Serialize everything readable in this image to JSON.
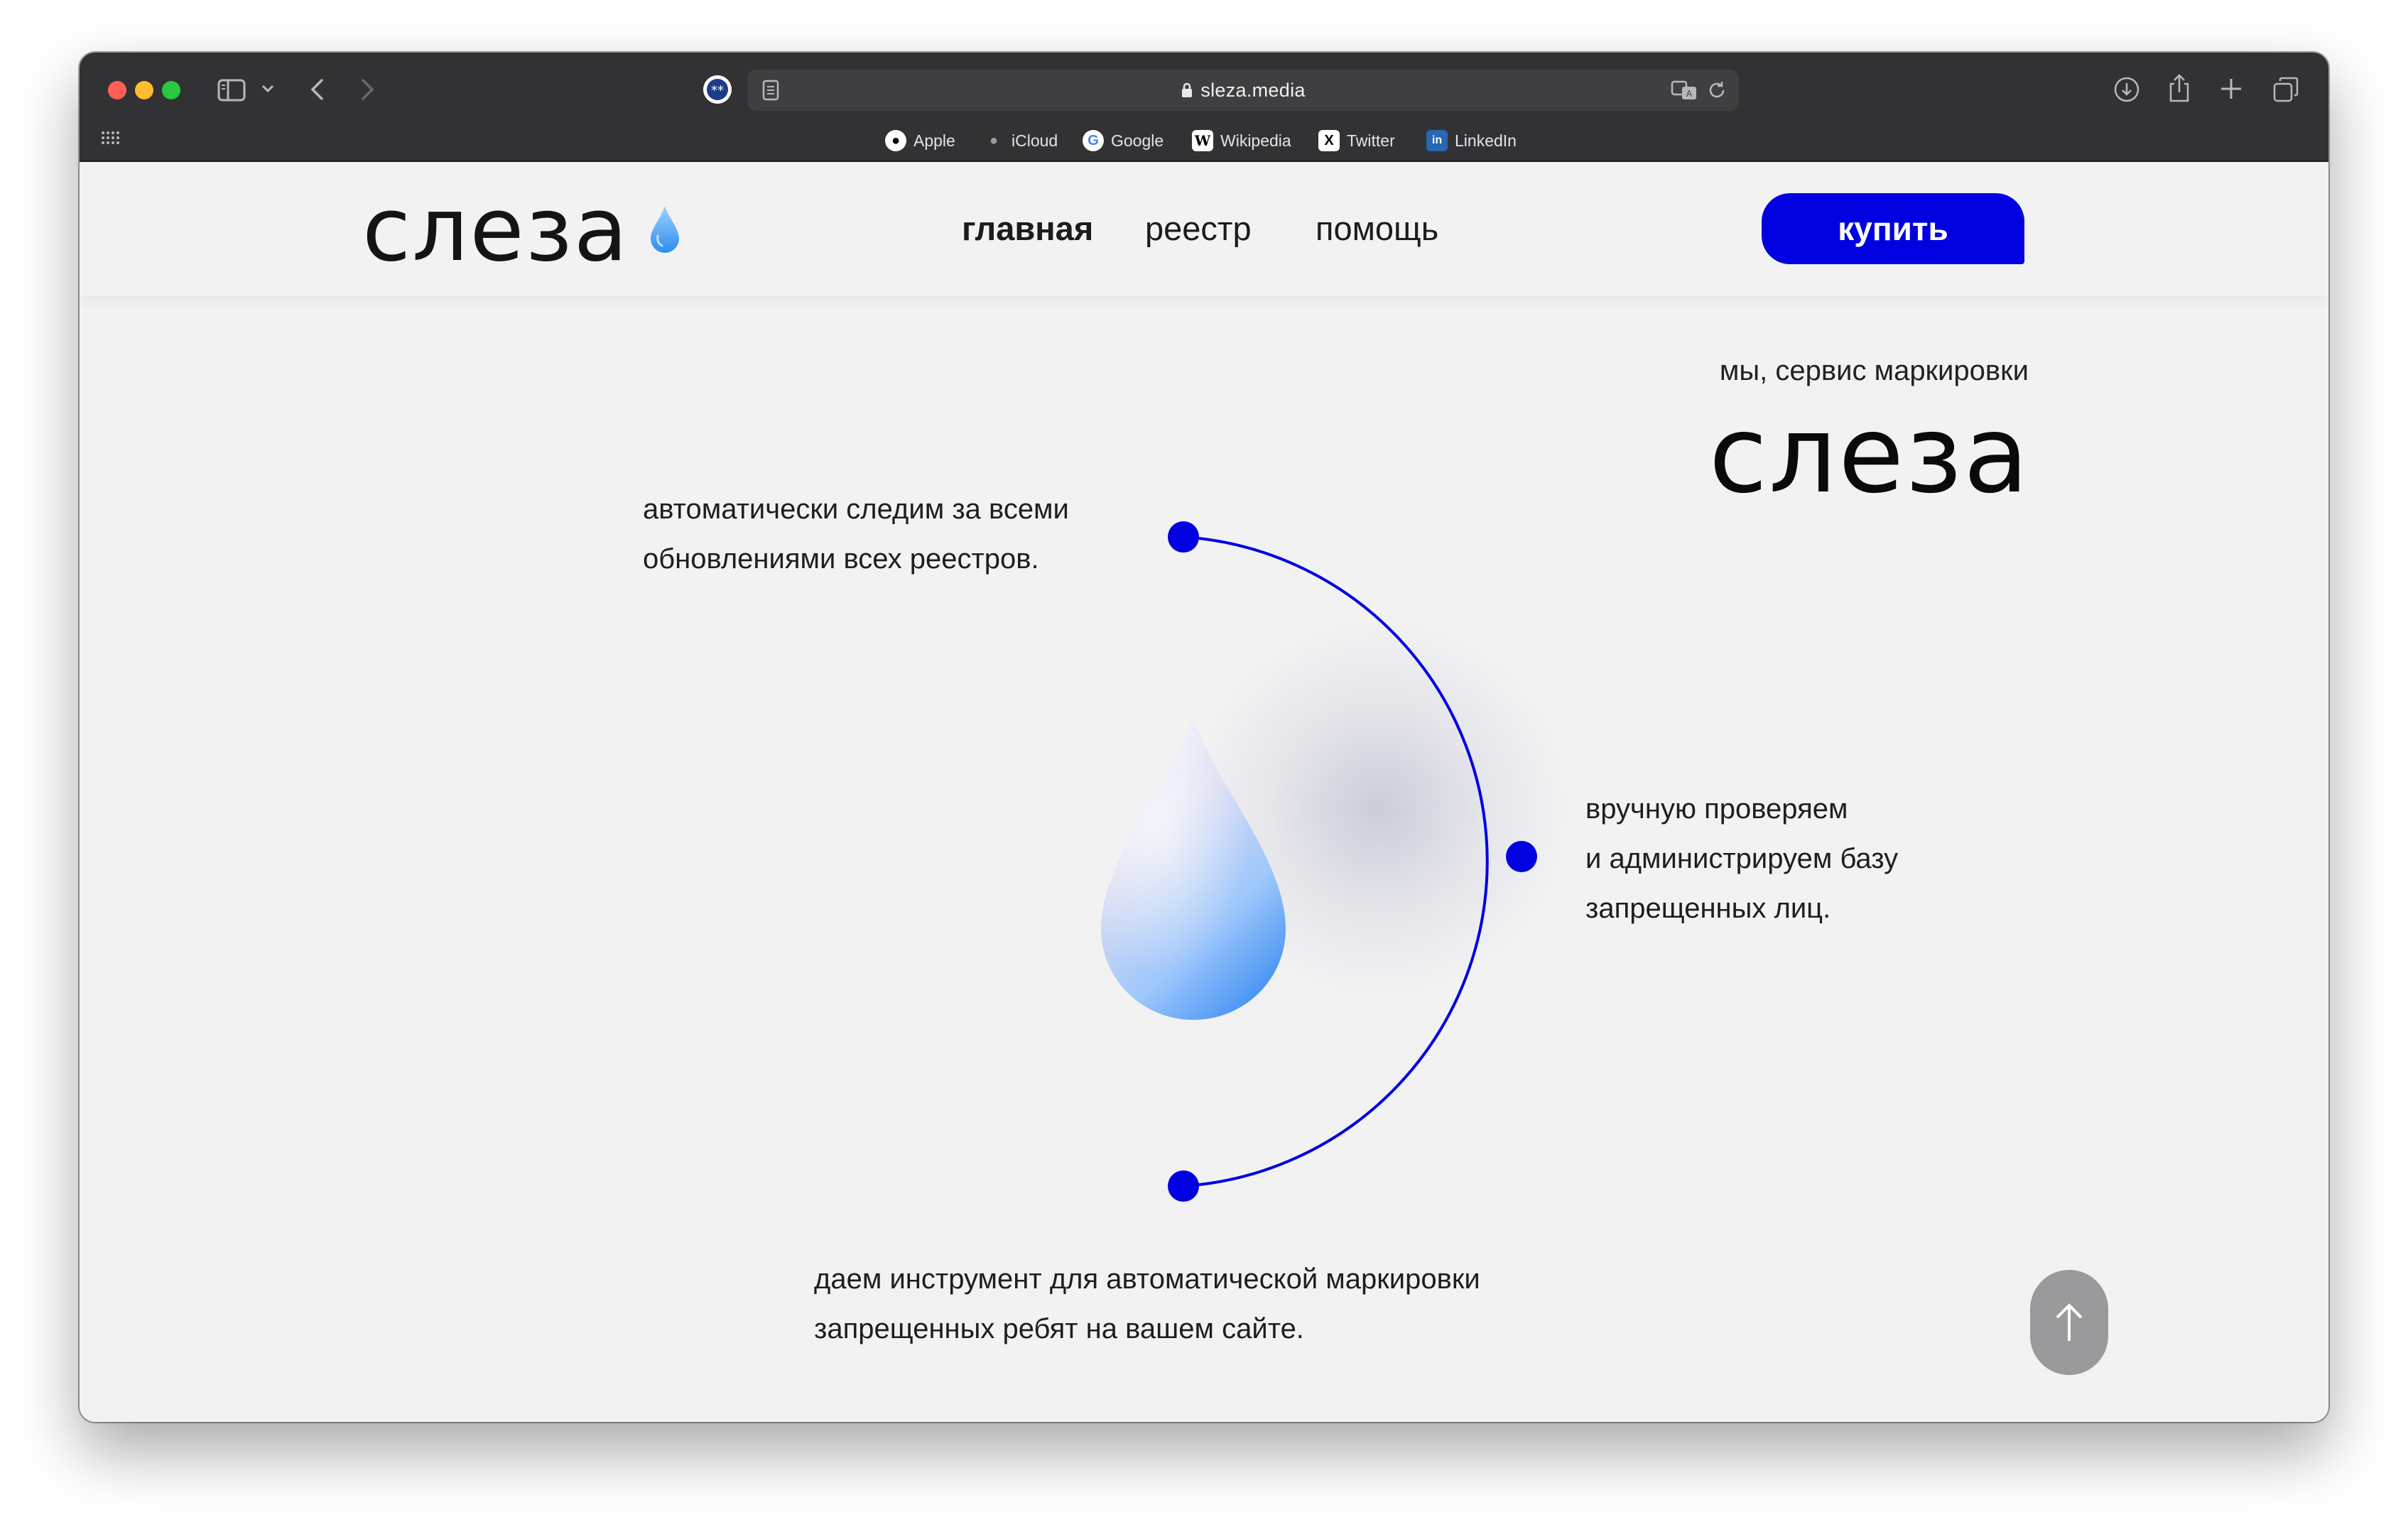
{
  "browser": {
    "url": "sleza.media",
    "bookmarks": [
      {
        "label": "Apple",
        "icon": "apple-icon"
      },
      {
        "label": "iCloud",
        "icon": "apple-icon"
      },
      {
        "label": "Google",
        "icon": "google-icon"
      },
      {
        "label": "Wikipedia",
        "icon": "wikipedia-icon"
      },
      {
        "label": "Twitter",
        "icon": "x-icon"
      },
      {
        "label": "LinkedIn",
        "icon": "linkedin-icon"
      }
    ]
  },
  "header": {
    "logo": "слеза",
    "nav": [
      "главная",
      "реестр",
      "помощь"
    ],
    "active_nav": "главная",
    "buy_label": "купить"
  },
  "hero": {
    "tagline": "мы, сервис маркировки",
    "word": "слеза"
  },
  "features": [
    {
      "lines": [
        "автоматически следим за всеми",
        "обновлениями всех реестров."
      ]
    },
    {
      "lines": [
        "вручную проверяем",
        "и администрируем базу",
        "запрещенных лиц."
      ]
    },
    {
      "lines": [
        "даем инструмент для автоматической маркировки",
        "запрещенных ребят на вашем сайте."
      ]
    }
  ],
  "colors": {
    "accent": "#0000e0",
    "background": "#f2f2f3",
    "titlebar": "#323234"
  }
}
